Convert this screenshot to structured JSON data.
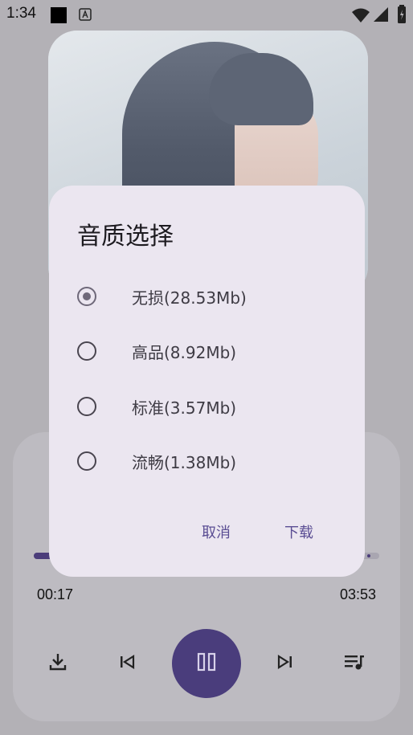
{
  "status_bar": {
    "time": "1:34"
  },
  "dialog": {
    "title": "音质选择",
    "options": [
      {
        "label": "无损(28.53Mb)",
        "checked": true
      },
      {
        "label": "高品(8.92Mb)",
        "checked": false
      },
      {
        "label": "标准(3.57Mb)",
        "checked": false
      },
      {
        "label": "流畅(1.38Mb)",
        "checked": false
      }
    ],
    "cancel_label": "取消",
    "download_label": "下载"
  },
  "player": {
    "current_time": "00:17",
    "total_time": "03:53",
    "progress": 0.073,
    "icons": [
      "download-icon",
      "previous-icon",
      "pause-icon",
      "next-icon",
      "playlist-icon"
    ]
  },
  "colors": {
    "accent": "#4a3d7c",
    "dialog_bg": "#ebe6f0",
    "text_button": "#5a4d93"
  }
}
